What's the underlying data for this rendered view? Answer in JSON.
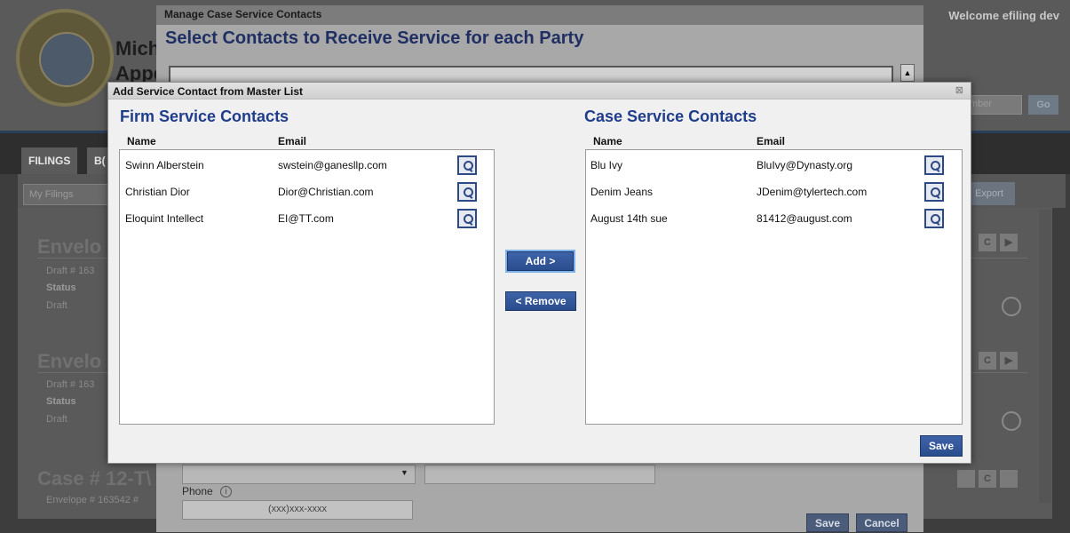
{
  "background": {
    "court_name_line1": "Mich",
    "court_name_line2": "Appe",
    "welcome": "Welcome efiling dev",
    "search_placeholder": "mber",
    "go_label": "Go",
    "tabs": [
      {
        "label": "FILINGS"
      },
      {
        "label": "B("
      }
    ],
    "my_filings": "My Filings",
    "export_label": "Export",
    "envelopes": [
      {
        "title": "Envelo",
        "draft": "Draft # 163",
        "status_label": "Status",
        "status_value": "Draft"
      },
      {
        "title": "Envelo",
        "draft": "Draft # 163",
        "status_label": "Status",
        "status_value": "Draft"
      }
    ],
    "case_title": "Case # 12-T\\",
    "case_meta": "Envelope # 163542 #"
  },
  "manage_modal": {
    "title": "Manage Case Service Contacts",
    "heading": "Select Contacts to Receive Service for each Party",
    "phone_label": "Phone",
    "phone_placeholder": "(xxx)xxx-xxxx",
    "save_label": "Save",
    "cancel_label": "Cancel"
  },
  "modal": {
    "title": "Add Service Contact from Master List",
    "close_icon": "⊠",
    "firm": {
      "title": "Firm Service Contacts",
      "col_name": "Name",
      "col_email": "Email",
      "rows": [
        {
          "name": "Swinn Alberstein",
          "email": "swstein@ganesllp.com"
        },
        {
          "name": "Christian Dior",
          "email": "Dior@Christian.com"
        },
        {
          "name": "Eloquint Intellect",
          "email": "EI@TT.com"
        }
      ]
    },
    "case": {
      "title": "Case Service Contacts",
      "col_name": "Name",
      "col_email": "Email",
      "rows": [
        {
          "name": "Blu Ivy",
          "email": "BluIvy@Dynasty.org"
        },
        {
          "name": "Denim Jeans",
          "email": "JDenim@tylertech.com"
        },
        {
          "name": "August 14th sue",
          "email": "81412@august.com"
        }
      ]
    },
    "add_label": "Add >",
    "remove_label": "< Remove",
    "save_label": "Save"
  }
}
